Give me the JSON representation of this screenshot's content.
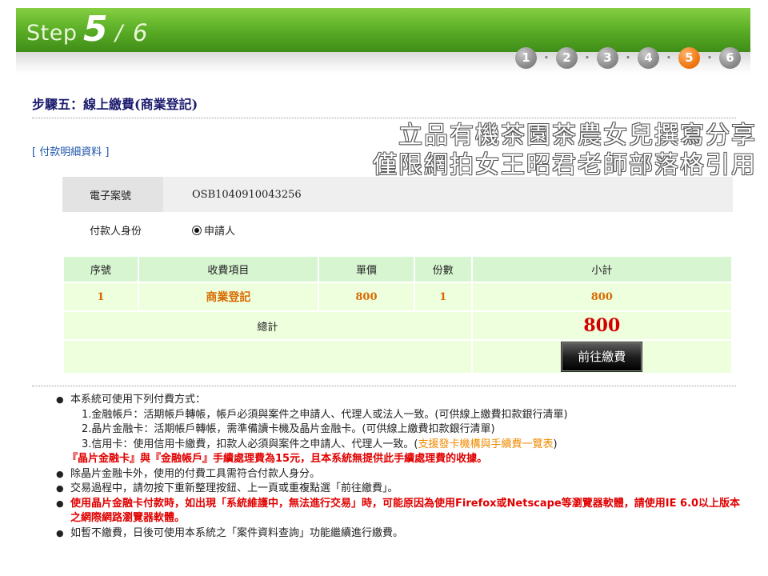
{
  "header": {
    "step_word": "Step",
    "step_num": "5",
    "step_slash": "/",
    "step_total": "6",
    "steps": [
      "1",
      "2",
      "3",
      "4",
      "5",
      "6"
    ],
    "active_step": 5,
    "colors": {
      "banner": "#5eb128",
      "active_step": "#f07a16",
      "inactive_step": "#8d8d8d"
    }
  },
  "page_title": "步驟五：線上繳費(商業登記)",
  "watermark": {
    "line1": "立品有機茶園茶農女兒撰寫分享",
    "line2": "僅限網拍女王昭君老師部落格引用"
  },
  "section_label": "[ 付款明細資料 ]",
  "case_info": {
    "case_no_label": "電子案號",
    "case_no": "OSB1040910043256",
    "payer_label": "付款人身份",
    "payer_value": "申請人"
  },
  "fee_table": {
    "headers": [
      "序號",
      "收費項目",
      "單價",
      "份數",
      "小計"
    ],
    "rows": [
      {
        "no": "1",
        "item": "商業登記",
        "price": "800",
        "qty": "1",
        "subtotal": "800"
      }
    ],
    "total_label": "總計",
    "total_amount": "800",
    "pay_button": "前往繳費"
  },
  "notes": {
    "n1": "本系統可使用下列付費方式：",
    "n1_a": "1.金融帳戶：活期帳戶轉帳，帳戶必須與案件之申請人、代理人或法人一致。(可供線上繳費扣款銀行清單)",
    "n1_b": "2.晶片金融卡：活期帳戶轉帳，需準備讀卡機及晶片金融卡。(可供線上繳費扣款銀行清單)",
    "n1_c_pre": "3.信用卡：使用信用卡繳費，扣款人必須與案件之申請人、代理人一致。(",
    "n1_c_link": "支援發卡機構與手續費一覽表",
    "n1_c_post": ")",
    "n1_red": "『晶片金融卡』與『金融帳戶』手續處理費為15元，且本系統無提供此手續處理費的收據。",
    "n2": "除晶片金融卡外，使用的付費工具需符合付款人身分。",
    "n3": "交易過程中，請勿按下重新整理按鈕、上一頁或重複點選「前往繳費」。",
    "n4": "使用晶片金融卡付款時，如出現「系統維護中，無法進行交易」時，可能原因為使用Firefox或Netscape等瀏覽器軟體，請使用IE 6.0以上版本之網際網路瀏覽器軟體。",
    "n5": "如暫不繳費，日後可使用本系統之「案件資料查詢」功能繼續進行繳費。"
  }
}
